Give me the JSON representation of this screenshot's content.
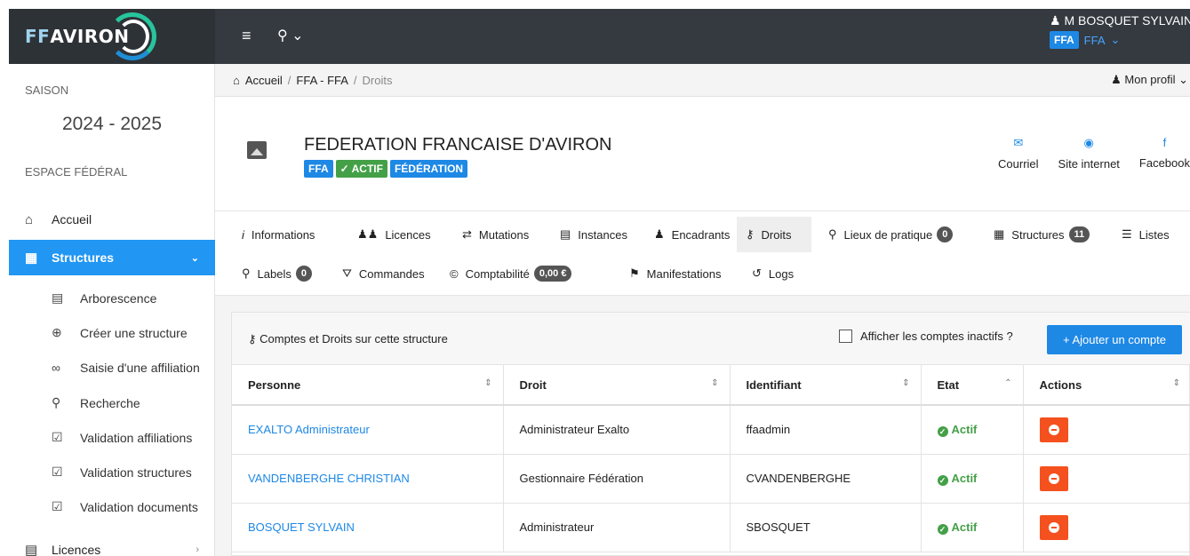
{
  "topbar": {
    "logo_prefix": "FF",
    "logo_main": "AVIRON",
    "menu_icon": "hamburger-icon",
    "search_icon": "search-icon",
    "user_name": "M BOSQUET SYLVAIN",
    "user_badge": "FFA",
    "user_org": "FFA"
  },
  "sidebar": {
    "season_label": "SAISON",
    "season_value": "2024 - 2025",
    "space_label": "ESPACE FÉDÉRAL",
    "home": "Accueil",
    "structures": "Structures",
    "sub_items": [
      "Arborescence",
      "Créer une structure",
      "Saisie d'une affiliation",
      "Recherche",
      "Validation affiliations",
      "Validation structures",
      "Validation documents"
    ],
    "licences": "Licences"
  },
  "breadcrumb": {
    "home": "Accueil",
    "org": "FFA - FFA",
    "current": "Droits",
    "profile": "Mon profil"
  },
  "org": {
    "title": "FEDERATION FRANCAISE D'AVIRON",
    "tags": [
      "FFA",
      "✓ ACTIF",
      "FÉDÉRATION"
    ],
    "links": [
      "Courriel",
      "Site internet",
      "Facebook"
    ]
  },
  "tabs": {
    "informations": "Informations",
    "licences": "Licences",
    "mutations": "Mutations",
    "instances": "Instances",
    "encadrants": "Encadrants",
    "droits": "Droits",
    "lieux": "Lieux de pratique",
    "lieux_count": "0",
    "structures": "Structures",
    "structures_count": "11",
    "listes": "Listes",
    "labels": "Labels",
    "labels_count": "0",
    "commandes": "Commandes",
    "comptabilite": "Comptabilité",
    "comptabilite_value": "0,00 €",
    "manifestations": "Manifestations",
    "logs": "Logs"
  },
  "panel": {
    "title": "Comptes et Droits sur cette structure",
    "show_inactive": "Afficher les comptes inactifs ?",
    "add_button": "+ Ajouter un compte",
    "columns": [
      "Personne",
      "Droit",
      "Identifiant",
      "Etat",
      "Actions"
    ],
    "rows": [
      {
        "personne": "EXALTO Administrateur",
        "droit": "Administrateur Exalto",
        "identifiant": "ffaadmin",
        "etat": "Actif"
      },
      {
        "personne": "VANDENBERGHE CHRISTIAN",
        "droit": "Gestionnaire Fédération",
        "identifiant": "CVANDENBERGHE",
        "etat": "Actif"
      },
      {
        "personne": "BOSQUET SYLVAIN",
        "droit": "Administrateur",
        "identifiant": "SBOSQUET",
        "etat": "Actif"
      }
    ]
  },
  "colors": {
    "primary": "#1e88e5",
    "success": "#43a047",
    "danger": "#f4511e",
    "topbar": "#343a40"
  }
}
